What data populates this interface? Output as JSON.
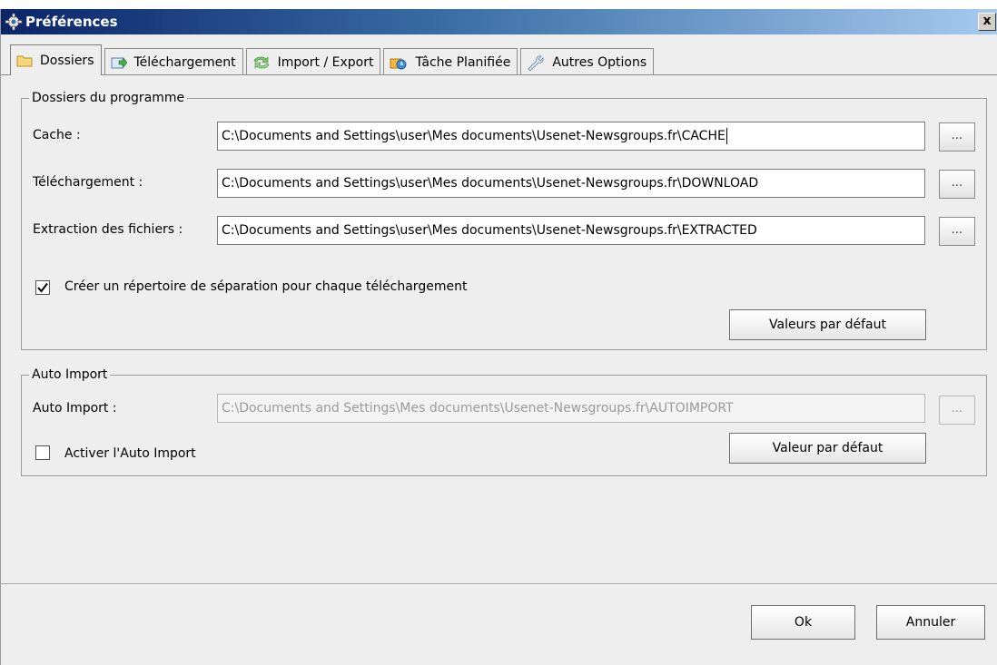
{
  "window": {
    "title": "Préférences",
    "close_label": "x"
  },
  "tabs": [
    {
      "label": "Dossiers",
      "icon": "folder-icon"
    },
    {
      "label": "Téléchargement",
      "icon": "download-icon"
    },
    {
      "label": "Import / Export",
      "icon": "sync-arrows-icon"
    },
    {
      "label": "Tâche Planifiée",
      "icon": "schedule-icon"
    },
    {
      "label": "Autres Options",
      "icon": "wrench-icon"
    }
  ],
  "program_folders": {
    "legend": "Dossiers du programme",
    "cache_label": "Cache :",
    "cache_value": "C:\\Documents and Settings\\user\\Mes documents\\Usenet-Newsgroups.fr\\CACHE",
    "download_label": "Téléchargement :",
    "download_value": "C:\\Documents and Settings\\user\\Mes documents\\Usenet-Newsgroups.fr\\DOWNLOAD",
    "extract_label": "Extraction des fichiers :",
    "extract_value": "C:\\Documents and Settings\\user\\Mes documents\\Usenet-Newsgroups.fr\\EXTRACTED",
    "browse_label": "...",
    "separate_dir_label": "Créer un répertoire de séparation pour chaque téléchargement",
    "separate_dir_checked": true,
    "defaults_button": "Valeurs par défaut"
  },
  "auto_import": {
    "legend": "Auto Import",
    "label": "Auto Import :",
    "value": "C:\\Documents and Settings\\Mes documents\\Usenet-Newsgroups.fr\\AUTOIMPORT",
    "browse_label": "...",
    "enable_label": "Activer l'Auto Import",
    "enable_checked": false,
    "default_button": "Valeur par défaut"
  },
  "footer": {
    "ok": "Ok",
    "cancel": "Annuler"
  }
}
